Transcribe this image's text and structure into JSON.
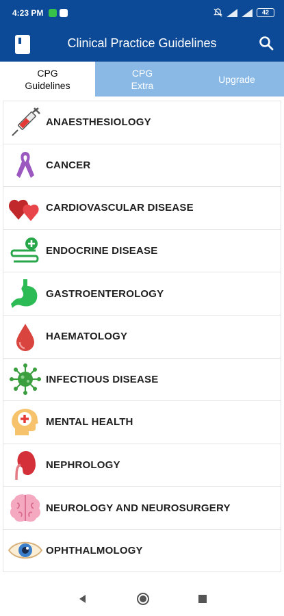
{
  "status": {
    "time": "4:23 PM",
    "battery": "42"
  },
  "app": {
    "title": "Clinical Practice Guidelines"
  },
  "tabs": [
    {
      "line1": "CPG",
      "line2": "Guidelines"
    },
    {
      "line1": "CPG",
      "line2": "Extra"
    },
    {
      "line1": "Upgrade",
      "line2": ""
    }
  ],
  "categories": [
    {
      "label": "ANAESTHESIOLOGY",
      "icon": "syringe-icon"
    },
    {
      "label": "CANCER",
      "icon": "awareness-ribbon-icon"
    },
    {
      "label": "CARDIOVASCULAR DISEASE",
      "icon": "hearts-icon"
    },
    {
      "label": "ENDOCRINE DISEASE",
      "icon": "endocrine-icon"
    },
    {
      "label": "GASTROENTEROLOGY",
      "icon": "stomach-icon"
    },
    {
      "label": "HAEMATOLOGY",
      "icon": "blood-drop-icon"
    },
    {
      "label": "INFECTIOUS DISEASE",
      "icon": "virus-icon"
    },
    {
      "label": "MENTAL HEALTH",
      "icon": "head-plus-icon"
    },
    {
      "label": "NEPHROLOGY",
      "icon": "kidney-icon"
    },
    {
      "label": "NEUROLOGY AND NEUROSURGERY",
      "icon": "brain-icon"
    },
    {
      "label": "OPHTHALMOLOGY",
      "icon": "eye-icon"
    }
  ],
  "colors": {
    "primary": "#0c4a97",
    "tab_inactive": "#8ab9e6"
  }
}
